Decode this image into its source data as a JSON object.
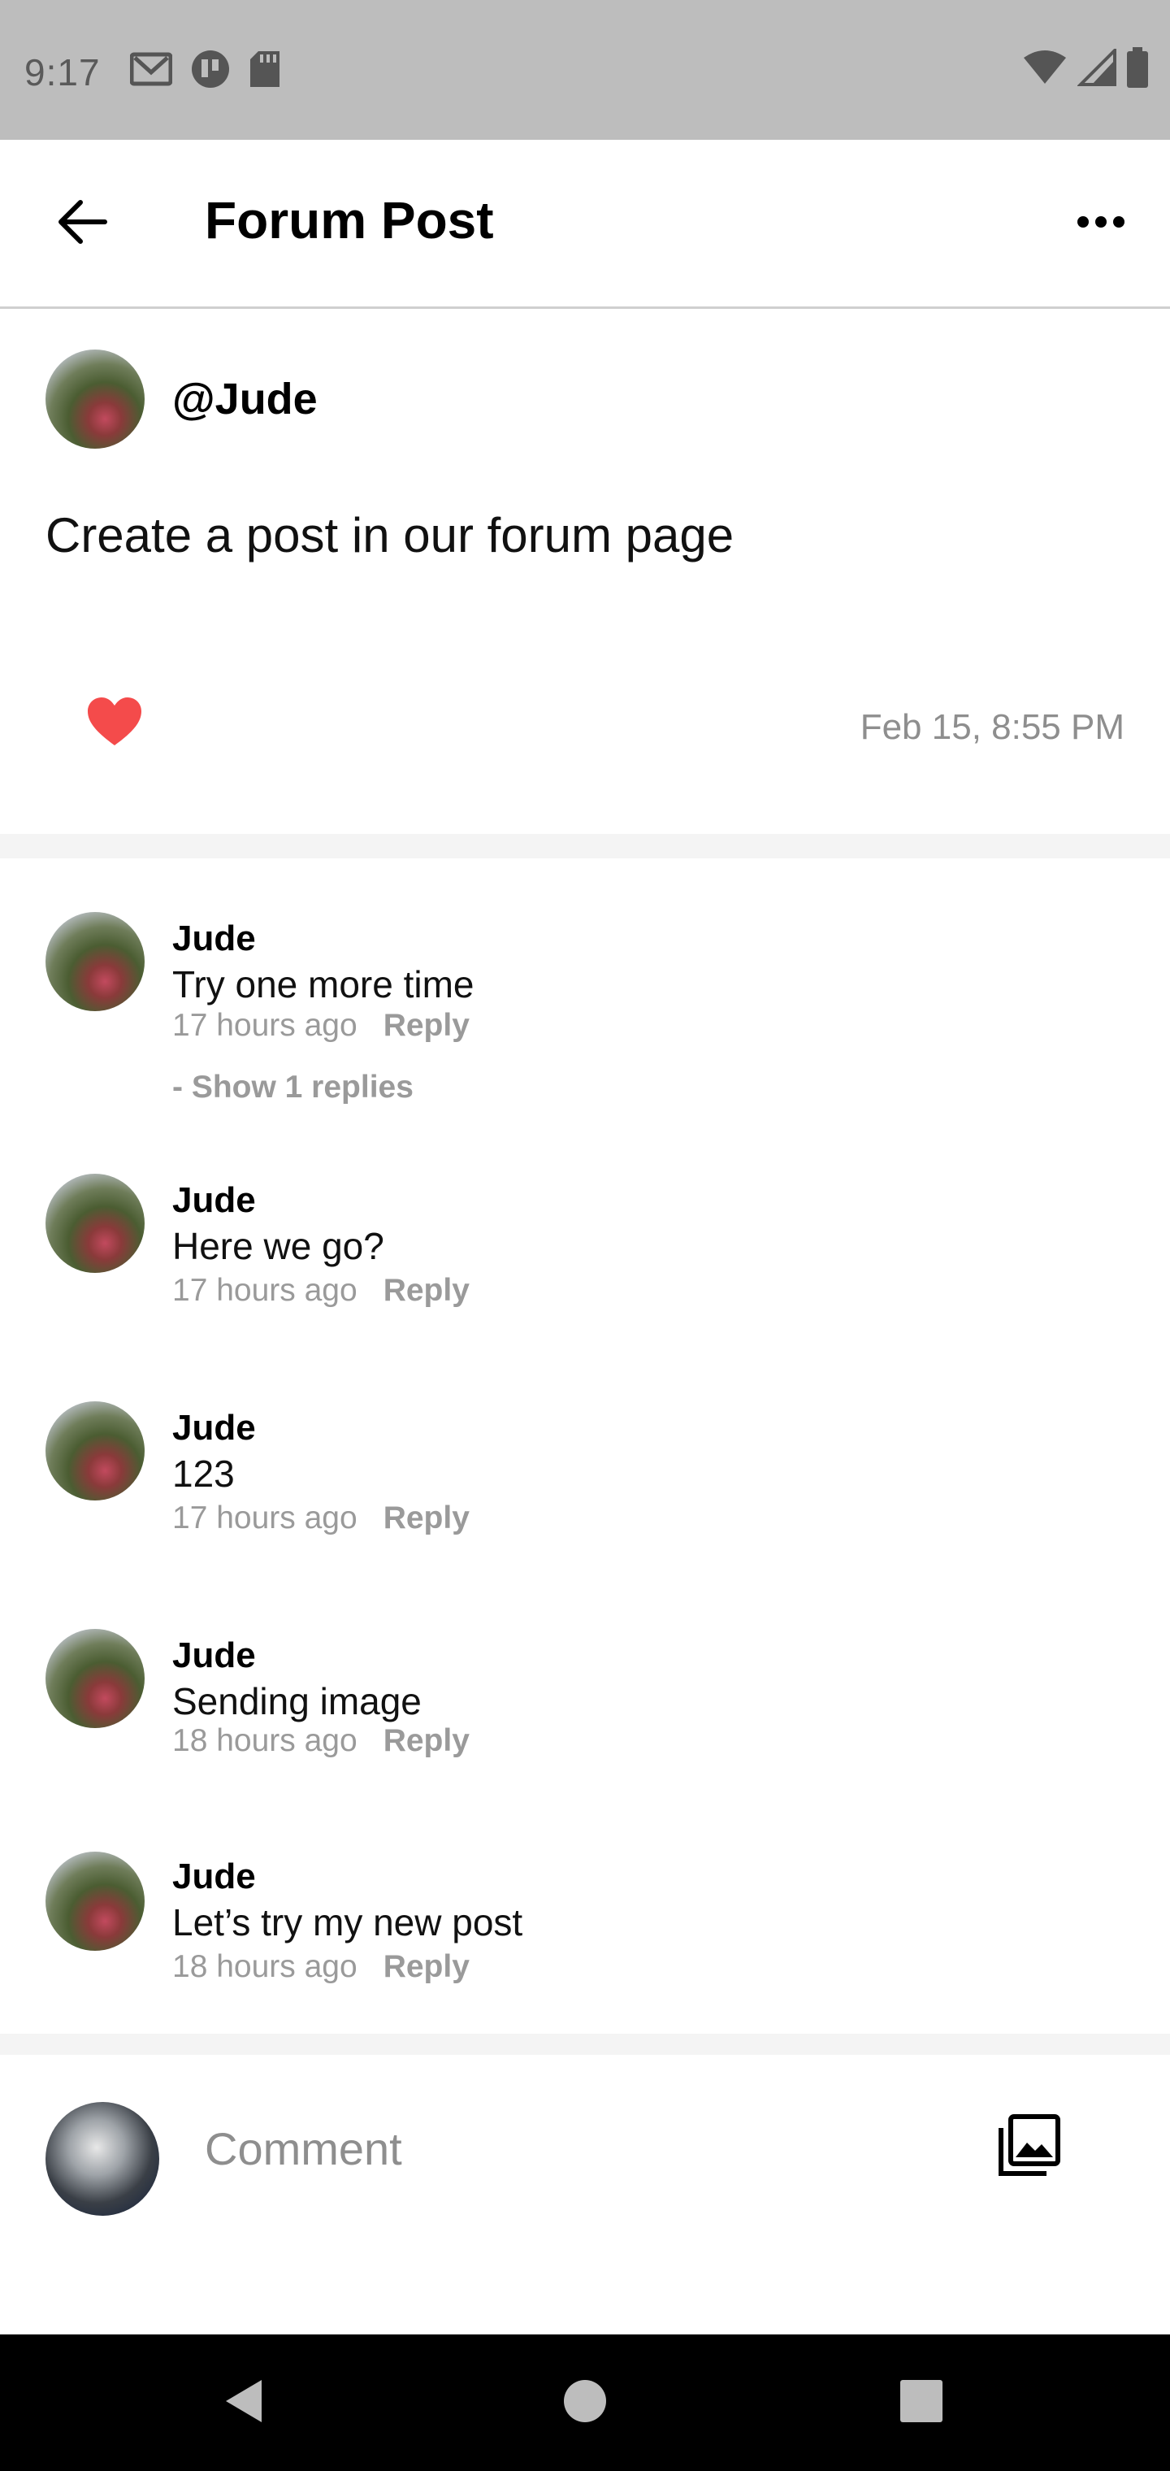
{
  "status_bar": {
    "time": "9:17",
    "left_icons": [
      "gmail-icon",
      "app-icon",
      "sd-card-icon"
    ],
    "right_icons": [
      "wifi-icon",
      "cell-signal-icon",
      "battery-icon"
    ]
  },
  "app_bar": {
    "title": "Forum Post",
    "back_icon": "back-arrow-icon",
    "more_icon": "more-horizontal-icon"
  },
  "post": {
    "username": "@Jude",
    "body": "Create a post in our forum page",
    "liked": true,
    "date": "Feb 15, 8:55 PM",
    "colors": {
      "heart": "#f44b4b"
    }
  },
  "comments": [
    {
      "name": "Jude",
      "text": "Try one more time",
      "time": "17 hours ago",
      "reply_label": "Reply",
      "show_replies": "- Show 1 replies"
    },
    {
      "name": "Jude",
      "text": "Here we go?",
      "time": "17 hours ago",
      "reply_label": "Reply"
    },
    {
      "name": "Jude",
      "text": "123",
      "time": "17 hours ago",
      "reply_label": "Reply"
    },
    {
      "name": "Jude",
      "text": "Sending image",
      "time": "18 hours ago",
      "reply_label": "Reply"
    },
    {
      "name": "Jude",
      "text": "Let’s try my new post",
      "time": "18 hours ago",
      "reply_label": "Reply"
    }
  ],
  "composer": {
    "placeholder": "Comment",
    "gallery_icon": "gallery-icon"
  },
  "nav_bar": {
    "buttons": [
      "back-triangle-icon",
      "home-circle-icon",
      "recents-square-icon"
    ]
  }
}
